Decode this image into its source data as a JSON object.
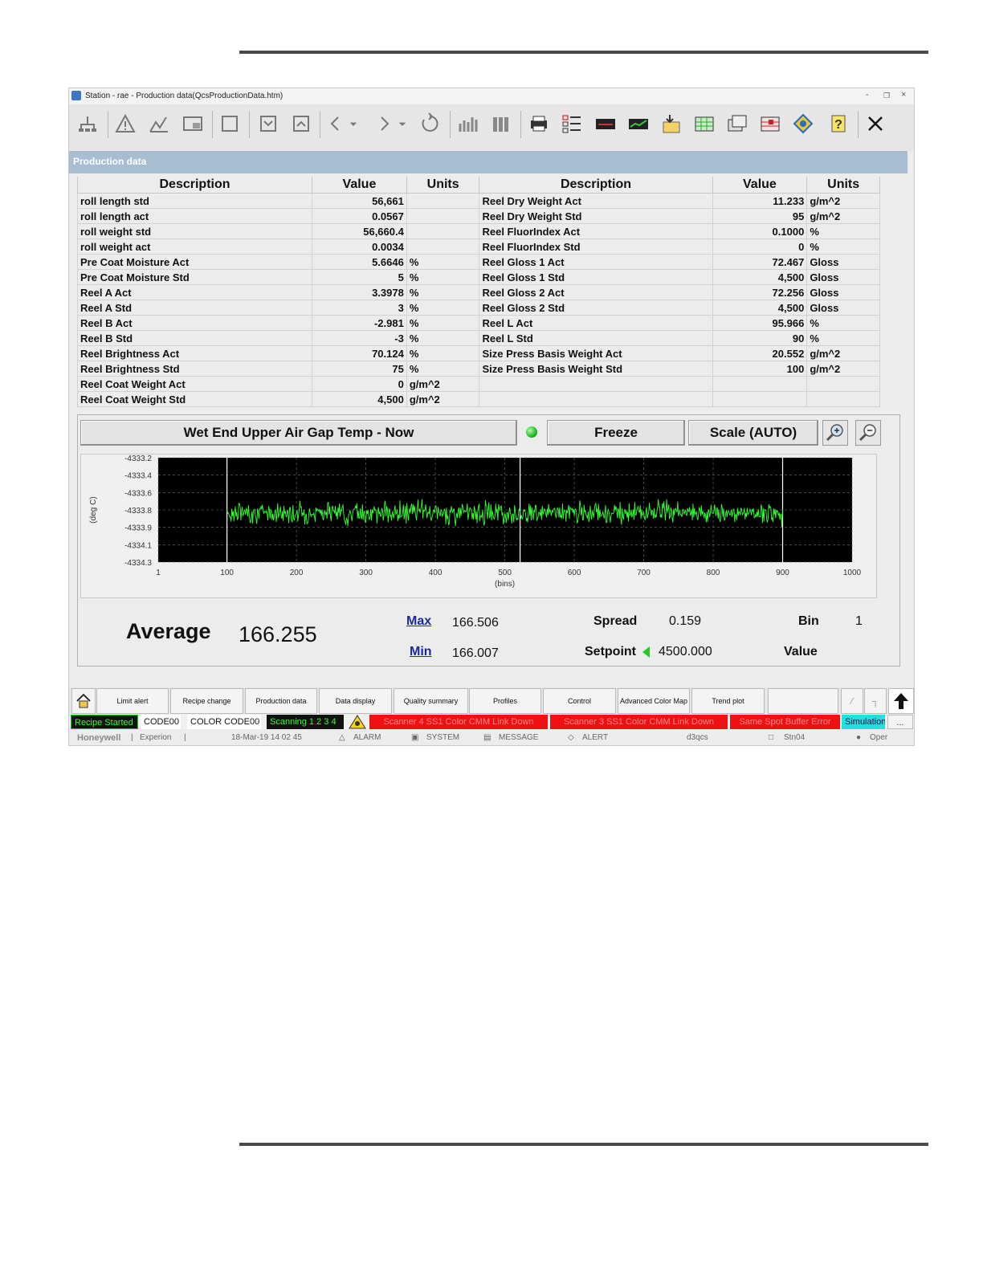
{
  "window": {
    "title": "Station - rae - Production data(QcsProductionData.htm)",
    "controls": [
      "-",
      "❐",
      "×"
    ]
  },
  "header": {
    "title": "Production data"
  },
  "table": {
    "columns": [
      "Description",
      "Value",
      "Units",
      "Description",
      "Value",
      "Units"
    ],
    "rows": [
      [
        "roll length std",
        "56,661",
        "",
        "Reel Dry Weight Act",
        "11.233",
        "g/m^2"
      ],
      [
        "roll length act",
        "0.0567",
        "",
        "Reel Dry Weight Std",
        "95",
        "g/m^2"
      ],
      [
        "roll weight std",
        "56,660.4",
        "",
        "Reel FluorIndex Act",
        "0.1000",
        "%"
      ],
      [
        "roll weight act",
        "0.0034",
        "",
        "Reel FluorIndex Std",
        "0",
        "%"
      ],
      [
        "Pre Coat Moisture Act",
        "5.6646",
        "%",
        "Reel Gloss 1 Act",
        "72.467",
        "Gloss"
      ],
      [
        "Pre Coat Moisture Std",
        "5",
        "%",
        "Reel Gloss 1 Std",
        "4,500",
        "Gloss"
      ],
      [
        "Reel A Act",
        "3.3978",
        "%",
        "Reel Gloss 2 Act",
        "72.256",
        "Gloss"
      ],
      [
        "Reel A Std",
        "3",
        "%",
        "Reel Gloss 2 Std",
        "4,500",
        "Gloss"
      ],
      [
        "Reel B Act",
        "-2.981",
        "%",
        "Reel L Act",
        "95.966",
        "%"
      ],
      [
        "Reel B Std",
        "-3",
        "%",
        "Reel L Std",
        "90",
        "%"
      ],
      [
        "Reel Brightness Act",
        "70.124",
        "%",
        "Size Press Basis Weight Act",
        "20.552",
        "g/m^2"
      ],
      [
        "Reel Brightness Std",
        "75",
        "%",
        "Size Press Basis Weight Std",
        "100",
        "g/m^2"
      ],
      [
        "Reel Coat Weight Act",
        "0",
        "g/m^2",
        "",
        "",
        ""
      ],
      [
        "Reel Coat Weight Std",
        "4,500",
        "g/m^2",
        "",
        "",
        ""
      ]
    ]
  },
  "trend": {
    "name_label": "Wet End Upper Air Gap Temp - Now",
    "freeze_label": "Freeze",
    "scale_label": "Scale (AUTO)",
    "led_color": "#22bb22"
  },
  "chart_data": {
    "type": "line",
    "ylabel": "(deg C)",
    "xlabel": "(bins)",
    "xlim": [
      1,
      1000
    ],
    "ylim": [
      -4334.3,
      -4333.2
    ],
    "x_ticks": [
      "1",
      "100",
      "200",
      "300",
      "400",
      "500",
      "600",
      "700",
      "800",
      "900",
      "1000"
    ],
    "y_ticks": [
      "-4333.2",
      "-4333.4",
      "-4333.6",
      "-4333.8",
      "-4333.9",
      "-4334.1",
      "-4334.3"
    ],
    "data_start_bin": 100,
    "data_end_bin": 900,
    "center_value": -4333.78,
    "noise_amplitude": 0.16,
    "vertical_markers": [
      100,
      522,
      900
    ],
    "background": "#000000",
    "series_color": "#33ff33",
    "grid": true
  },
  "stats": {
    "average_label": "Average",
    "average_value": "166.255",
    "max_label": "Max",
    "max_value": "166.506",
    "min_label": "Min",
    "min_value": "166.007",
    "spread_label": "Spread",
    "spread_value": "0.159",
    "setpoint_label": "Setpoint",
    "setpoint_value": "4500.000",
    "bin_label": "Bin",
    "bin_value": "1",
    "value_label": "Value"
  },
  "nav": {
    "items": [
      "Limit alert",
      "Recipe change",
      "Production data",
      "Data display",
      "Quality summary",
      "Profiles",
      "Control",
      "Advanced Color Map",
      "Trend plot"
    ]
  },
  "status": {
    "recipe": "Recipe Started",
    "code1": "CODE00",
    "code2": "COLOR CODE00",
    "scanning": "Scanning 1 2 3 4",
    "alarm1": "Scanner 4 SS1 Color CMM Link Down",
    "alarm2": "Scanner 3 SS1 Color CMM Link Down",
    "alarm3": "Same Spot Buffer Error",
    "sim": "Simulation",
    "more": "..."
  },
  "footer": {
    "brand": "Honeywell",
    "product": "Experion",
    "datetime": "18-Mar-19   14 02 45",
    "alarm": "ALARM",
    "system": "SYSTEM",
    "message": "MESSAGE",
    "alert": "ALERT",
    "server": "d3qcs",
    "station": "Stn04",
    "user": "Oper"
  },
  "colors": {
    "green_status": "#00c800",
    "red_alarm": "#ee1111",
    "cyan_sim": "#22e0e0",
    "header_bar": "#a6bdd2"
  }
}
